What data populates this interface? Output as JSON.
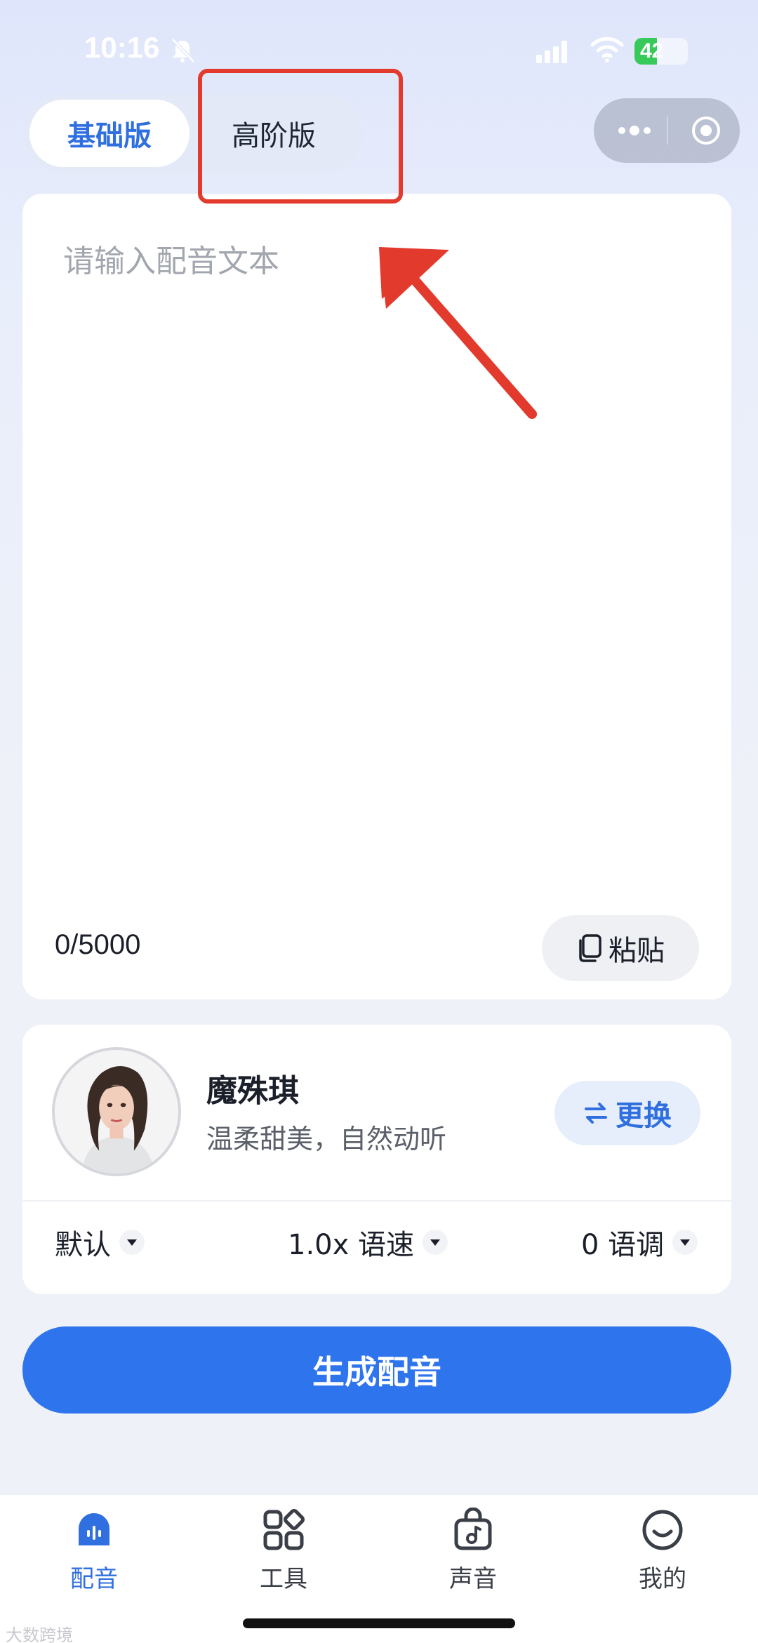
{
  "status_bar": {
    "time": "10:16",
    "battery_text": "42",
    "battery_level": 0.42
  },
  "tabs": {
    "basic": "基础版",
    "advanced": "高阶版",
    "active": "basic"
  },
  "editor": {
    "placeholder": "请输入配音文本",
    "value": "",
    "char_count": "0/5000",
    "paste_label": "粘贴"
  },
  "voice": {
    "name": "魔殊琪",
    "description": "温柔甜美，自然动听",
    "change_label": "更换",
    "style": "默认",
    "speed": "1.0x 语速",
    "pitch": "0 语调"
  },
  "generate_label": "生成配音",
  "nav": {
    "items": [
      {
        "label": "配音",
        "icon": "dubbing-icon",
        "active": true
      },
      {
        "label": "工具",
        "icon": "tools-icon",
        "active": false
      },
      {
        "label": "声音",
        "icon": "voice-bag-icon",
        "active": false
      },
      {
        "label": "我的",
        "icon": "smiley-icon",
        "active": false
      }
    ]
  },
  "watermark": "大数跨境",
  "colors": {
    "accent": "#2e74ec",
    "annotation": "#e23b2e"
  }
}
